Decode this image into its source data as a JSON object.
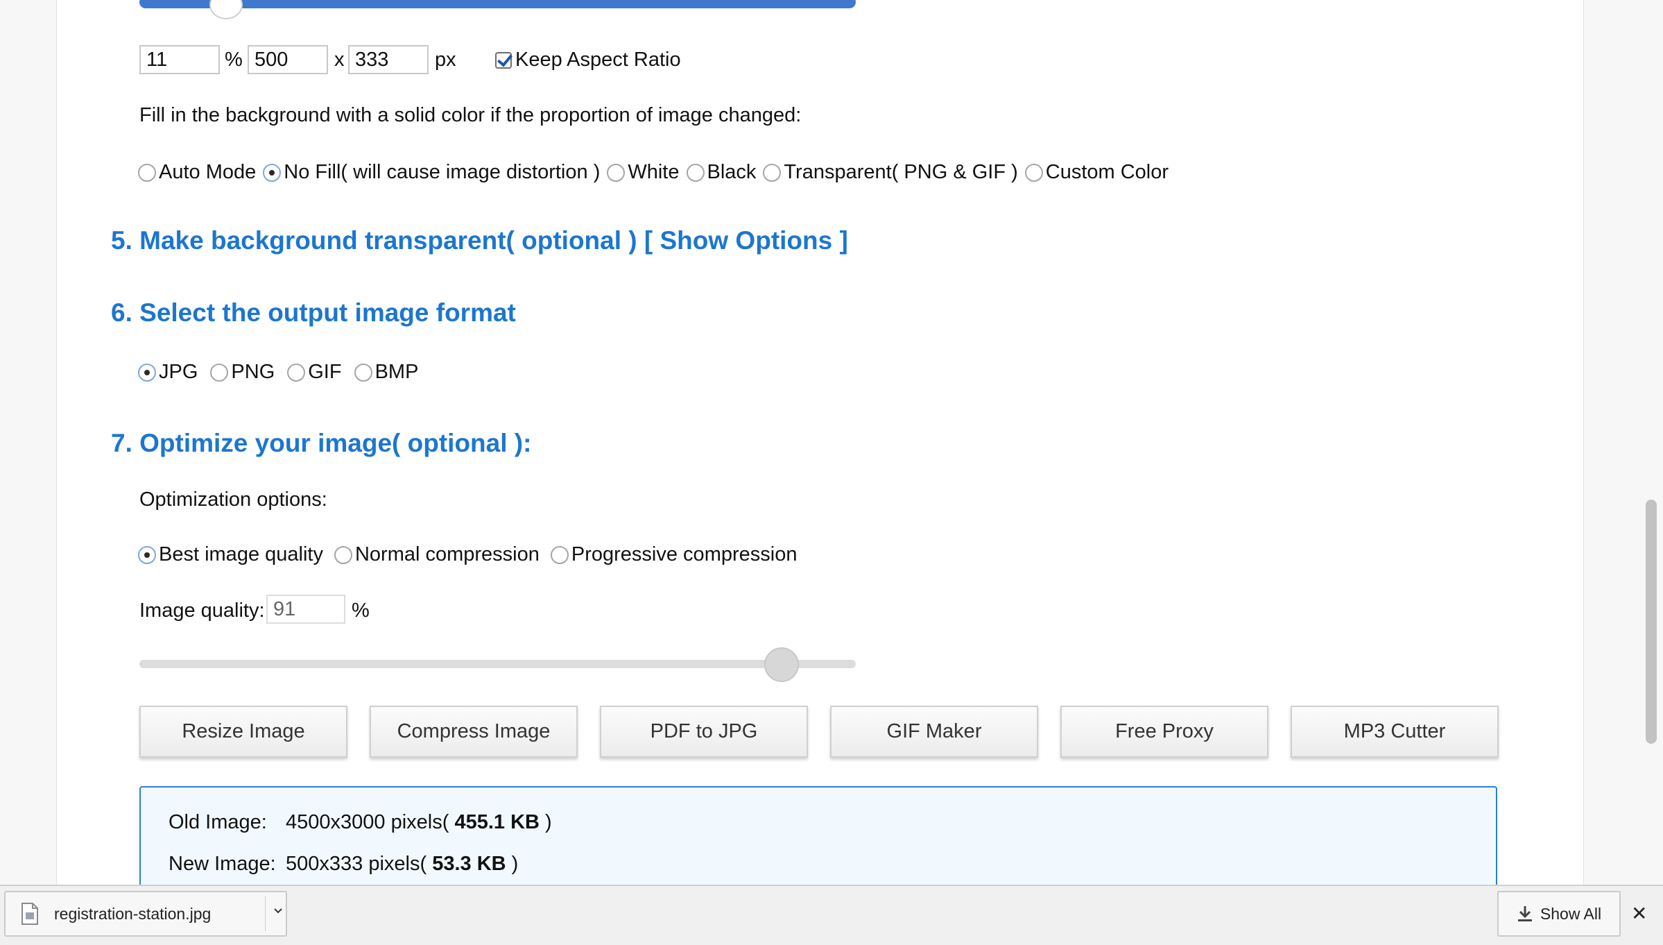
{
  "resize": {
    "percent": "11",
    "percent_sign": "%",
    "width": "500",
    "x": "x",
    "height": "333",
    "unit": "px",
    "keep_aspect_label": "Keep Aspect Ratio",
    "keep_aspect_checked": true,
    "slider_level_fraction": 0.11
  },
  "fill": {
    "prompt": "Fill in the background with a solid color if the proportion of image changed:",
    "options": [
      "Auto Mode",
      "No Fill( will cause image distortion )",
      "White",
      "Black",
      "Transparent( PNG & GIF )",
      "Custom Color"
    ],
    "selected": "No Fill( will cause image distortion )"
  },
  "section5": {
    "title": "5. Make background transparent( optional )",
    "link": "[ Show Options ]"
  },
  "section6": {
    "title": "6. Select the output image format",
    "formats": [
      "JPG",
      "PNG",
      "GIF",
      "BMP"
    ],
    "selected": "JPG"
  },
  "section7": {
    "title": "7. Optimize your image( optional ):",
    "options_label": "Optimization options:",
    "options": [
      "Best image quality",
      "Normal compression",
      "Progressive compression"
    ],
    "selected": "Best image quality",
    "quality_label": "Image quality:",
    "quality_value": "91",
    "quality_unit": "%",
    "quality_level_fraction": 0.91
  },
  "tools": [
    "Resize Image",
    "Compress Image",
    "PDF to JPG",
    "GIF Maker",
    "Free Proxy",
    "MP3 Cutter"
  ],
  "result": {
    "old_label": "Old Image:",
    "old_value": "4500x3000 pixels(",
    "old_size": "455.1 KB",
    "old_close": ")",
    "new_label": "New Image:",
    "new_value": "500x333 pixels(",
    "new_size": "53.3 KB",
    "new_close": ")"
  },
  "download_bar": {
    "filename": "registration-station.jpg",
    "show_all": "Show All",
    "close": "✕"
  },
  "colors": {
    "accent": "#1c76d0",
    "slider_fill": "#3f78cd",
    "info_border": "#2c7fd0",
    "info_bg": "#f1f9ff"
  }
}
